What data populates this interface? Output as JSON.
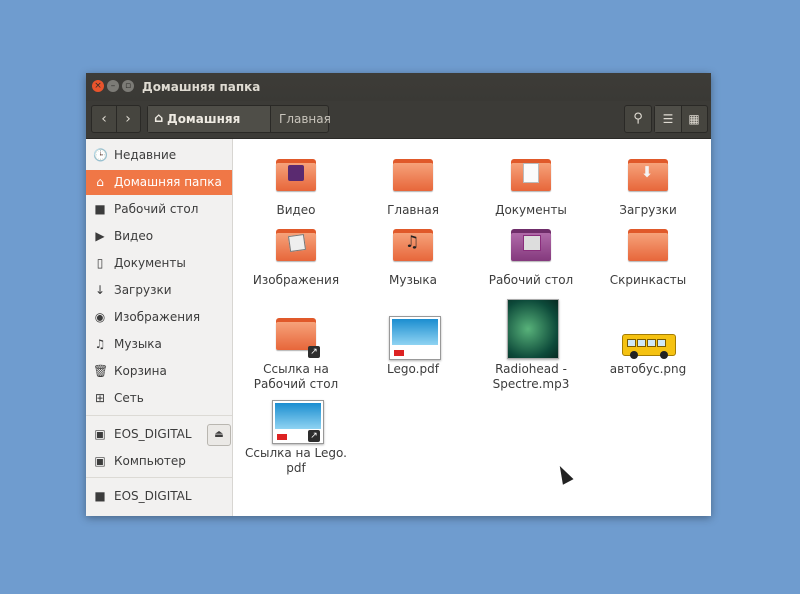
{
  "window": {
    "title": "Домашняя папка"
  },
  "toolbar": {
    "back_icon": "‹",
    "forward_icon": "›",
    "breadcrumb_current": "Домашняя папка",
    "breadcrumb_next": "Главная",
    "home_icon": "⌂",
    "search_icon": "🔍",
    "list_view_icon": "☰",
    "grid_view_icon": "▦"
  },
  "sidebar": {
    "items": [
      {
        "label": "Недавние",
        "icon": "🕒"
      },
      {
        "label": "Домашняя папка",
        "icon": "⌂",
        "active": true
      },
      {
        "label": "Рабочий стол",
        "icon": "■"
      },
      {
        "label": "Видео",
        "icon": "▶"
      },
      {
        "label": "Документы",
        "icon": "▯"
      },
      {
        "label": "Загрузки",
        "icon": "↓"
      },
      {
        "label": "Изображения",
        "icon": "◉"
      },
      {
        "label": "Музыка",
        "icon": "♫"
      },
      {
        "label": "Корзина",
        "icon": "🗑"
      },
      {
        "label": "Сеть",
        "icon": "⊞"
      }
    ],
    "devices": [
      {
        "label": "EOS_DIGITAL",
        "icon": "▣",
        "eject_icon": "⏏"
      },
      {
        "label": "Компьютер",
        "icon": "▣"
      }
    ],
    "network": [
      {
        "label": "EOS_DIGITAL",
        "icon": "■"
      }
    ]
  },
  "files": [
    {
      "label": "Видео",
      "kind": "folder",
      "emblem": "film"
    },
    {
      "label": "Главная",
      "kind": "folder",
      "emblem": ""
    },
    {
      "label": "Документы",
      "kind": "folder",
      "emblem": "doc"
    },
    {
      "label": "Загрузки",
      "kind": "folder",
      "emblem": "down"
    },
    {
      "label": "Изображения",
      "kind": "folder",
      "emblem": "image"
    },
    {
      "label": "Музыка",
      "kind": "folder",
      "emblem": "music"
    },
    {
      "label": "Рабочий стол",
      "kind": "folder-purple",
      "emblem": "desk"
    },
    {
      "label": "Скринкасты",
      "kind": "folder",
      "emblem": ""
    },
    {
      "label": "Ссылка на\nРабочий стол",
      "kind": "folder-link"
    },
    {
      "label": "Lego.pdf",
      "kind": "pdf"
    },
    {
      "label": "Radiohead -\nSpectre.mp3",
      "kind": "mp3"
    },
    {
      "label": "автобус.png",
      "kind": "image"
    },
    {
      "label": "Ссылка на Lego.\npdf",
      "kind": "pdf-link"
    }
  ],
  "colors": {
    "accent": "#f07746",
    "desktop": "#6f9ccf",
    "titlebar": "#3c3b37"
  }
}
